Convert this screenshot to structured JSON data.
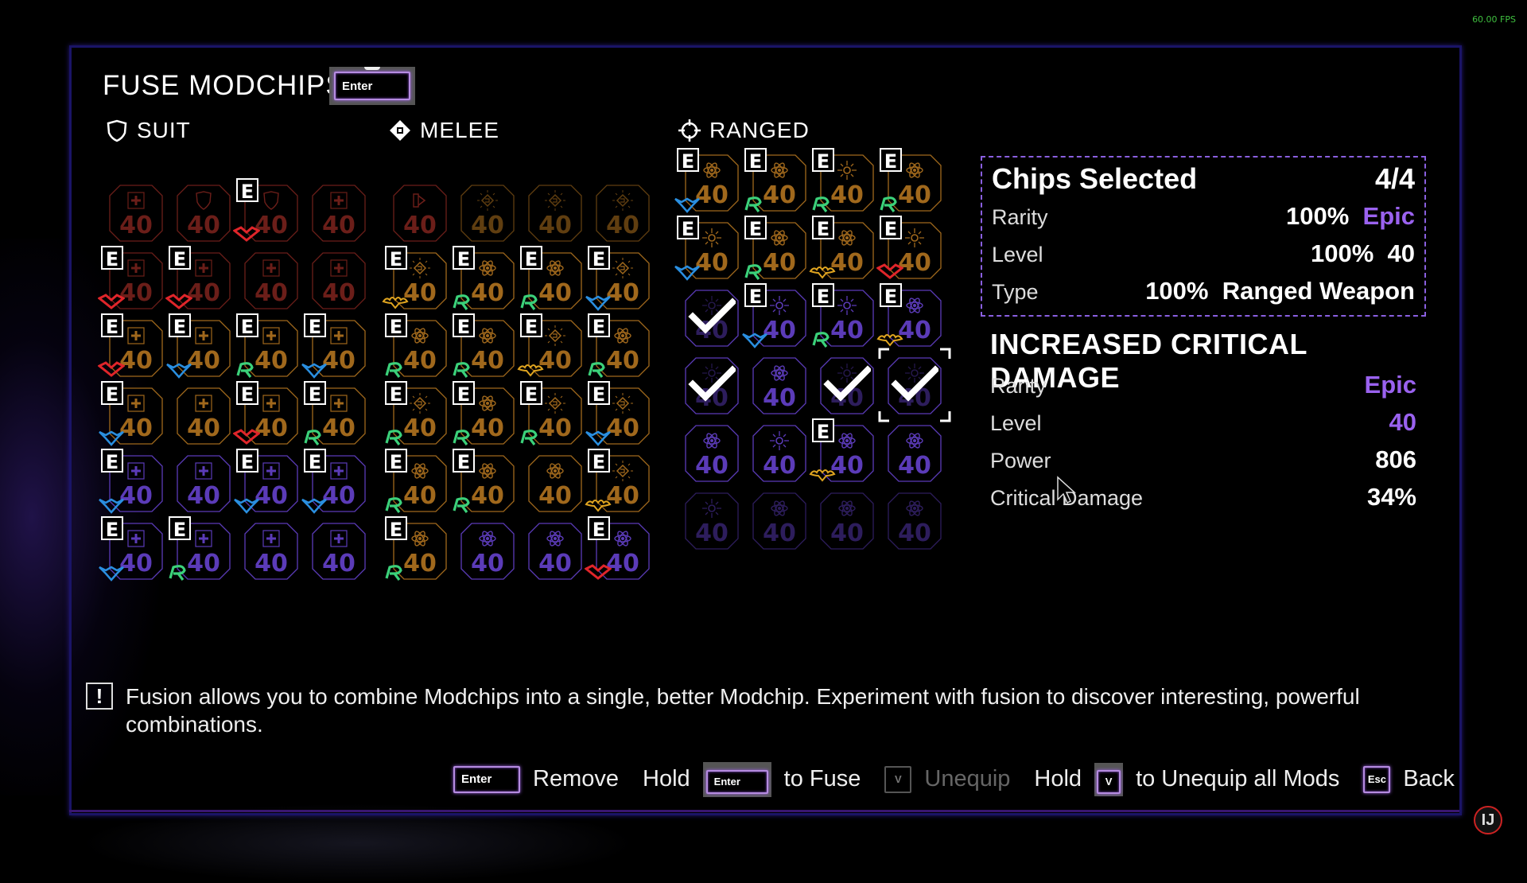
{
  "overlay": {
    "fps": "60.00 FPS"
  },
  "header": {
    "title": "FUSE MODCHIPS?",
    "confirm_key": "Enter"
  },
  "sections": [
    {
      "label": "SUIT",
      "icon": "shield-icon"
    },
    {
      "label": "MELEE",
      "icon": "melee-diamond-icon"
    },
    {
      "label": "RANGED",
      "icon": "crosshair-icon"
    }
  ],
  "grids": {
    "suit": [
      {
        "glyph": "plus",
        "rarity": "legendary",
        "level": "40",
        "equipped": false,
        "mark": null,
        "state": "dim"
      },
      {
        "glyph": "shield",
        "rarity": "legendary",
        "level": "40",
        "equipped": false,
        "mark": null,
        "state": "dim"
      },
      {
        "glyph": "shield",
        "rarity": "legendary",
        "level": "40",
        "equipped": true,
        "mark": "red-heart",
        "state": "dim"
      },
      {
        "glyph": "plus",
        "rarity": "legendary",
        "level": "40",
        "equipped": false,
        "mark": null,
        "state": "dim"
      },
      {
        "glyph": "plus",
        "rarity": "legendary",
        "level": "40",
        "equipped": true,
        "mark": "red-heart",
        "state": "dim"
      },
      {
        "glyph": "plus",
        "rarity": "legendary",
        "level": "40",
        "equipped": true,
        "mark": "red-heart",
        "state": "dim"
      },
      {
        "glyph": "plus",
        "rarity": "legendary",
        "level": "40",
        "equipped": false,
        "mark": null,
        "state": "dim"
      },
      {
        "glyph": "plus",
        "rarity": "legendary",
        "level": "40",
        "equipped": false,
        "mark": null,
        "state": "dim"
      },
      {
        "glyph": "plus",
        "rarity": "orange",
        "level": "40",
        "equipped": true,
        "mark": "red-heart",
        "state": "normal"
      },
      {
        "glyph": "plus",
        "rarity": "orange",
        "level": "40",
        "equipped": true,
        "mark": "blue-wing",
        "state": "normal"
      },
      {
        "glyph": "plus",
        "rarity": "orange",
        "level": "40",
        "equipped": true,
        "mark": "green-r",
        "state": "normal"
      },
      {
        "glyph": "plus",
        "rarity": "orange",
        "level": "40",
        "equipped": true,
        "mark": "blue-wing",
        "state": "normal"
      },
      {
        "glyph": "plus",
        "rarity": "orange",
        "level": "40",
        "equipped": true,
        "mark": "blue-wing",
        "state": "normal"
      },
      {
        "glyph": "plus",
        "rarity": "orange",
        "level": "40",
        "equipped": false,
        "mark": null,
        "state": "normal"
      },
      {
        "glyph": "plus",
        "rarity": "orange",
        "level": "40",
        "equipped": true,
        "mark": "red-heart",
        "state": "normal"
      },
      {
        "glyph": "plus",
        "rarity": "orange",
        "level": "40",
        "equipped": true,
        "mark": "green-r",
        "state": "normal"
      },
      {
        "glyph": "plus",
        "rarity": "epic",
        "level": "40",
        "equipped": true,
        "mark": "blue-wing",
        "state": "normal"
      },
      {
        "glyph": "plus",
        "rarity": "epic",
        "level": "40",
        "equipped": false,
        "mark": null,
        "state": "normal"
      },
      {
        "glyph": "plus",
        "rarity": "epic",
        "level": "40",
        "equipped": true,
        "mark": "blue-wing",
        "state": "normal"
      },
      {
        "glyph": "plus",
        "rarity": "epic",
        "level": "40",
        "equipped": true,
        "mark": "blue-wing",
        "state": "normal"
      },
      {
        "glyph": "plus",
        "rarity": "epic",
        "level": "40",
        "equipped": true,
        "mark": "blue-wing",
        "state": "normal"
      },
      {
        "glyph": "plus",
        "rarity": "epic",
        "level": "40",
        "equipped": true,
        "mark": "green-r",
        "state": "normal"
      },
      {
        "glyph": "plus",
        "rarity": "epic",
        "level": "40",
        "equipped": false,
        "mark": null,
        "state": "normal"
      },
      {
        "glyph": "plus",
        "rarity": "epic",
        "level": "40",
        "equipped": false,
        "mark": null,
        "state": "normal"
      }
    ],
    "melee": [
      {
        "glyph": "fist",
        "rarity": "legendary",
        "level": "40",
        "equipped": false,
        "mark": null,
        "state": "dim"
      },
      {
        "glyph": "fist-burst",
        "rarity": "orange",
        "level": "40",
        "equipped": false,
        "mark": null,
        "state": "dim"
      },
      {
        "glyph": "fist-burst",
        "rarity": "orange",
        "level": "40",
        "equipped": false,
        "mark": null,
        "state": "dim"
      },
      {
        "glyph": "fist-burst",
        "rarity": "orange",
        "level": "40",
        "equipped": false,
        "mark": null,
        "state": "dim"
      },
      {
        "glyph": "fist-burst",
        "rarity": "orange",
        "level": "40",
        "equipped": true,
        "mark": "yellow-bat",
        "state": "normal"
      },
      {
        "glyph": "atom",
        "rarity": "orange",
        "level": "40",
        "equipped": true,
        "mark": "green-r",
        "state": "normal"
      },
      {
        "glyph": "atom",
        "rarity": "orange",
        "level": "40",
        "equipped": true,
        "mark": "green-r",
        "state": "normal"
      },
      {
        "glyph": "fist-burst",
        "rarity": "orange",
        "level": "40",
        "equipped": true,
        "mark": "blue-wing",
        "state": "normal"
      },
      {
        "glyph": "atom",
        "rarity": "orange",
        "level": "40",
        "equipped": true,
        "mark": "green-r",
        "state": "normal"
      },
      {
        "glyph": "atom",
        "rarity": "orange",
        "level": "40",
        "equipped": true,
        "mark": "green-r",
        "state": "normal"
      },
      {
        "glyph": "fist-burst",
        "rarity": "orange",
        "level": "40",
        "equipped": true,
        "mark": "yellow-bat",
        "state": "normal"
      },
      {
        "glyph": "atom",
        "rarity": "orange",
        "level": "40",
        "equipped": true,
        "mark": "green-r",
        "state": "normal"
      },
      {
        "glyph": "fist-burst",
        "rarity": "orange",
        "level": "40",
        "equipped": true,
        "mark": "green-r",
        "state": "normal"
      },
      {
        "glyph": "atom",
        "rarity": "orange",
        "level": "40",
        "equipped": true,
        "mark": "green-r",
        "state": "normal"
      },
      {
        "glyph": "fist-burst",
        "rarity": "orange",
        "level": "40",
        "equipped": true,
        "mark": "green-r",
        "state": "normal"
      },
      {
        "glyph": "fist-burst",
        "rarity": "orange",
        "level": "40",
        "equipped": true,
        "mark": "blue-wing",
        "state": "normal"
      },
      {
        "glyph": "atom",
        "rarity": "orange",
        "level": "40",
        "equipped": true,
        "mark": "green-r",
        "state": "normal"
      },
      {
        "glyph": "atom",
        "rarity": "orange",
        "level": "40",
        "equipped": true,
        "mark": "green-r",
        "state": "normal"
      },
      {
        "glyph": "atom",
        "rarity": "orange",
        "level": "40",
        "equipped": false,
        "mark": null,
        "state": "normal"
      },
      {
        "glyph": "fist-burst",
        "rarity": "orange",
        "level": "40",
        "equipped": true,
        "mark": "yellow-bat",
        "state": "normal"
      },
      {
        "glyph": "atom",
        "rarity": "orange",
        "level": "40",
        "equipped": true,
        "mark": "green-r",
        "state": "normal"
      },
      {
        "glyph": "atom",
        "rarity": "epic",
        "level": "40",
        "equipped": false,
        "mark": null,
        "state": "normal"
      },
      {
        "glyph": "atom",
        "rarity": "epic",
        "level": "40",
        "equipped": false,
        "mark": null,
        "state": "normal"
      },
      {
        "glyph": "atom",
        "rarity": "epic",
        "level": "40",
        "equipped": true,
        "mark": "red-heart",
        "state": "normal"
      }
    ],
    "ranged": [
      {
        "glyph": "atom",
        "rarity": "orange",
        "level": "40",
        "equipped": true,
        "mark": "blue-wing",
        "state": "normal"
      },
      {
        "glyph": "atom",
        "rarity": "orange",
        "level": "40",
        "equipped": true,
        "mark": "green-r",
        "state": "normal"
      },
      {
        "glyph": "burst",
        "rarity": "orange",
        "level": "40",
        "equipped": true,
        "mark": "green-r",
        "state": "normal"
      },
      {
        "glyph": "atom",
        "rarity": "orange",
        "level": "40",
        "equipped": true,
        "mark": "green-r",
        "state": "normal"
      },
      {
        "glyph": "burst",
        "rarity": "orange",
        "level": "40",
        "equipped": true,
        "mark": "blue-wing",
        "state": "normal"
      },
      {
        "glyph": "atom",
        "rarity": "orange",
        "level": "40",
        "equipped": true,
        "mark": "green-r",
        "state": "normal"
      },
      {
        "glyph": "atom",
        "rarity": "orange",
        "level": "40",
        "equipped": true,
        "mark": "yellow-bat",
        "state": "normal"
      },
      {
        "glyph": "burst",
        "rarity": "orange",
        "level": "40",
        "equipped": true,
        "mark": "red-heart",
        "state": "normal"
      },
      {
        "glyph": "burst",
        "rarity": "epic",
        "level": "40",
        "equipped": false,
        "mark": null,
        "state": "selected"
      },
      {
        "glyph": "burst",
        "rarity": "epic",
        "level": "40",
        "equipped": true,
        "mark": "blue-wing",
        "state": "normal"
      },
      {
        "glyph": "burst",
        "rarity": "epic",
        "level": "40",
        "equipped": true,
        "mark": "green-r",
        "state": "normal"
      },
      {
        "glyph": "atom",
        "rarity": "epic",
        "level": "40",
        "equipped": true,
        "mark": "yellow-bat",
        "state": "normal"
      },
      {
        "glyph": "burst",
        "rarity": "epic",
        "level": "40",
        "equipped": false,
        "mark": null,
        "state": "selected"
      },
      {
        "glyph": "atom",
        "rarity": "epic",
        "level": "40",
        "equipped": false,
        "mark": null,
        "state": "normal"
      },
      {
        "glyph": "burst",
        "rarity": "epic",
        "level": "40",
        "equipped": false,
        "mark": null,
        "state": "selected"
      },
      {
        "glyph": "burst",
        "rarity": "epic",
        "level": "40",
        "equipped": false,
        "mark": null,
        "state": "selected-focused"
      },
      {
        "glyph": "atom",
        "rarity": "epic",
        "level": "40",
        "equipped": false,
        "mark": null,
        "state": "normal"
      },
      {
        "glyph": "burst",
        "rarity": "epic",
        "level": "40",
        "equipped": false,
        "mark": null,
        "state": "normal"
      },
      {
        "glyph": "atom",
        "rarity": "epic",
        "level": "40",
        "equipped": true,
        "mark": "yellow-bat",
        "state": "normal"
      },
      {
        "glyph": "atom",
        "rarity": "epic",
        "level": "40",
        "equipped": false,
        "mark": null,
        "state": "normal"
      },
      {
        "glyph": "burst",
        "rarity": "epic",
        "level": "40",
        "equipped": false,
        "mark": null,
        "state": "normal"
      },
      {
        "glyph": "atom",
        "rarity": "epic",
        "level": "40",
        "equipped": false,
        "mark": null,
        "state": "normal"
      },
      {
        "glyph": "atom",
        "rarity": "epic",
        "level": "40",
        "equipped": false,
        "mark": null,
        "state": "normal"
      },
      {
        "glyph": "atom",
        "rarity": "epic",
        "level": "40",
        "equipped": false,
        "mark": null,
        "state": "normal"
      }
    ]
  },
  "summary": {
    "title": "Chips Selected",
    "count": "4/4",
    "rows": [
      {
        "label": "Rarity",
        "pct": "100%",
        "value": "Epic",
        "accent": true
      },
      {
        "label": "Level",
        "pct": "100%",
        "value": "40",
        "accent": false
      },
      {
        "label": "Type",
        "pct": "100%",
        "value": "Ranged Weapon",
        "accent": false
      }
    ]
  },
  "detail": {
    "title": "INCREASED CRITICAL DAMAGE",
    "rows": [
      {
        "label": "Rarity",
        "value": "Epic",
        "accent": true
      },
      {
        "label": "Level",
        "value": "40",
        "accent": true
      },
      {
        "label": "Power",
        "value": "806",
        "accent": false
      },
      {
        "label": "Critical Damage",
        "value": "34%",
        "accent": false
      }
    ]
  },
  "hint": {
    "text": "Fusion allows you to combine Modchips into a single, better Modchip. Experiment with fusion to discover interesting, powerful combinations."
  },
  "actions": {
    "remove_key": "Enter",
    "remove_label": "Remove",
    "hold_label": "Hold",
    "fuse_key": "Enter",
    "fuse_label": "to Fuse",
    "unequip_key": "V",
    "unequip_label": "Unequip",
    "hold2_label": "Hold",
    "unequip_all_key": "V",
    "unequip_all_label": "to Unequip all Mods",
    "back_key": "Esc",
    "back_label": "Back"
  },
  "colors": {
    "accent": "#9a62ef",
    "legendary": "#b3322a",
    "orange": "#a0681c",
    "epic": "#5b3bb8",
    "mark_red": "#e0252a",
    "mark_blue": "#2a8fe0",
    "mark_green": "#3bd17a",
    "mark_yellow": "#e0a520"
  }
}
